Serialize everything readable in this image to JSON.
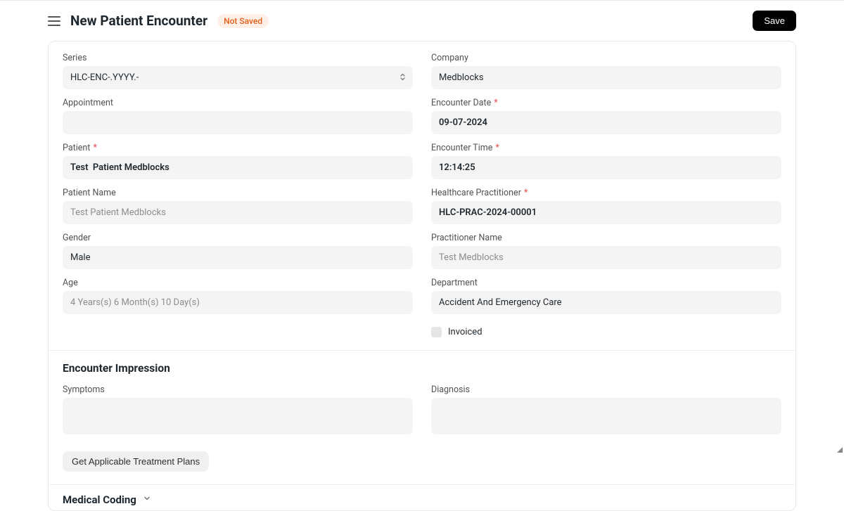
{
  "header": {
    "title": "New Patient Encounter",
    "badge": "Not Saved",
    "save_label": "Save"
  },
  "fields": {
    "series": {
      "label": "Series",
      "value": "HLC-ENC-.YYYY.-"
    },
    "appointment": {
      "label": "Appointment",
      "value": ""
    },
    "patient": {
      "label": "Patient",
      "value": "Test  Patient Medblocks"
    },
    "patient_name": {
      "label": "Patient Name",
      "value": "Test Patient Medblocks"
    },
    "gender": {
      "label": "Gender",
      "value": "Male"
    },
    "age": {
      "label": "Age",
      "value": "4 Years(s) 6 Month(s) 10 Day(s)"
    },
    "company": {
      "label": "Company",
      "value": "Medblocks"
    },
    "encounter_date": {
      "label": "Encounter Date",
      "value": "09-07-2024"
    },
    "encounter_time": {
      "label": "Encounter Time",
      "value": "12:14:25"
    },
    "healthcare_practitioner": {
      "label": "Healthcare Practitioner",
      "value": "HLC-PRAC-2024-00001"
    },
    "practitioner_name": {
      "label": "Practitioner Name",
      "value": "Test Medblocks"
    },
    "department": {
      "label": "Department",
      "value": "Accident And Emergency Care"
    },
    "invoiced": {
      "label": "Invoiced"
    }
  },
  "encounter_impression": {
    "title": "Encounter Impression",
    "symptoms_label": "Symptoms",
    "diagnosis_label": "Diagnosis",
    "treatment_btn": "Get Applicable Treatment Plans"
  },
  "medical_coding": {
    "title": "Medical Coding"
  }
}
